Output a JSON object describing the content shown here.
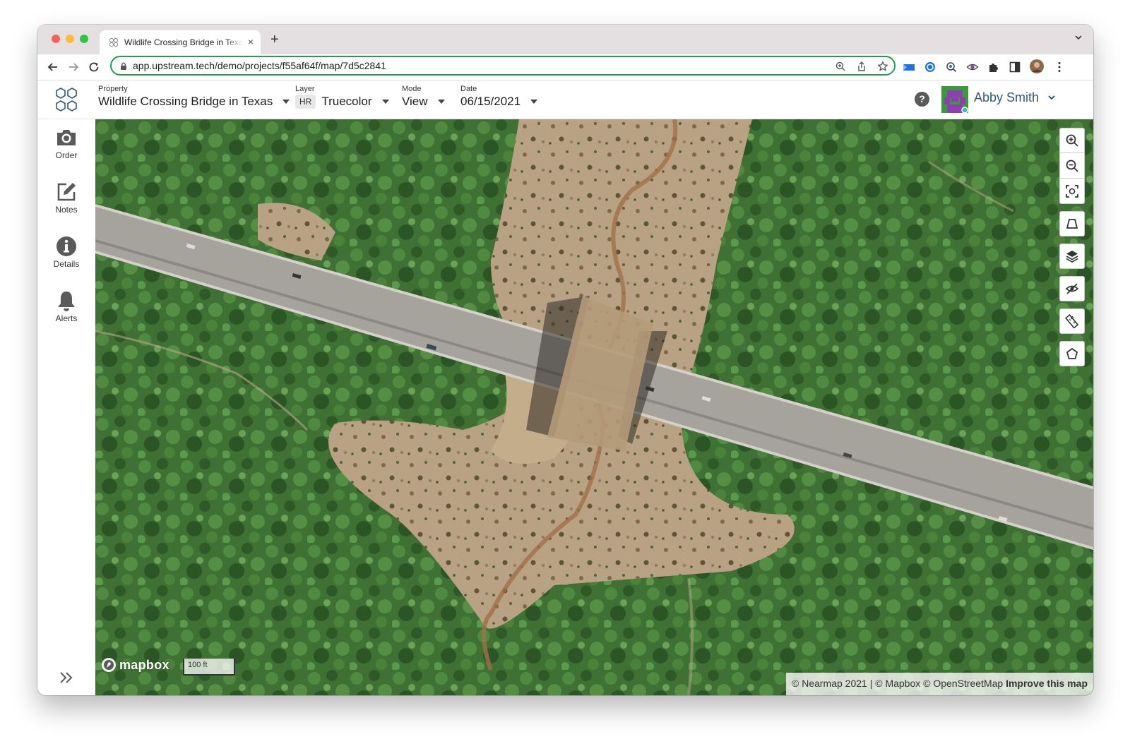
{
  "browser": {
    "tab_title": "Wildlife Crossing Bridge in Texas",
    "tab_close": "×",
    "new_tab": "+",
    "url": "app.upstream.tech/demo/projects/f55af64f/map/7d5c2841"
  },
  "header": {
    "property_label": "Property",
    "property_value": "Wildlife Crossing Bridge in Texas",
    "layer_label": "Layer",
    "layer_badge": "HR",
    "layer_value": "Truecolor",
    "mode_label": "Mode",
    "mode_value": "View",
    "date_label": "Date",
    "date_value": "06/15/2021",
    "help": "?",
    "user_name": "Abby Smith"
  },
  "sidebar": {
    "items": [
      {
        "label": "Order",
        "icon": "camera-icon"
      },
      {
        "label": "Notes",
        "icon": "edit-icon"
      },
      {
        "label": "Details",
        "icon": "info-icon"
      },
      {
        "label": "Alerts",
        "icon": "bell-icon"
      }
    ]
  },
  "map": {
    "logo_text": "mapbox",
    "scale": "100 ft",
    "attribution": "© Nearmap 2021 | © Mapbox © OpenStreetMap",
    "improve_link": "Improve this map",
    "controls": [
      "zoom-in-icon",
      "zoom-out-icon",
      "fit-bounds-icon",
      "perspective-icon",
      "layers-icon",
      "hide-icon",
      "ruler-icon",
      "draw-polygon-icon"
    ]
  },
  "colors": {
    "url_focus": "#1f9d55",
    "user_name": "#2e5a74",
    "forest": "#3c6b32",
    "highway": "#a6a39d"
  }
}
